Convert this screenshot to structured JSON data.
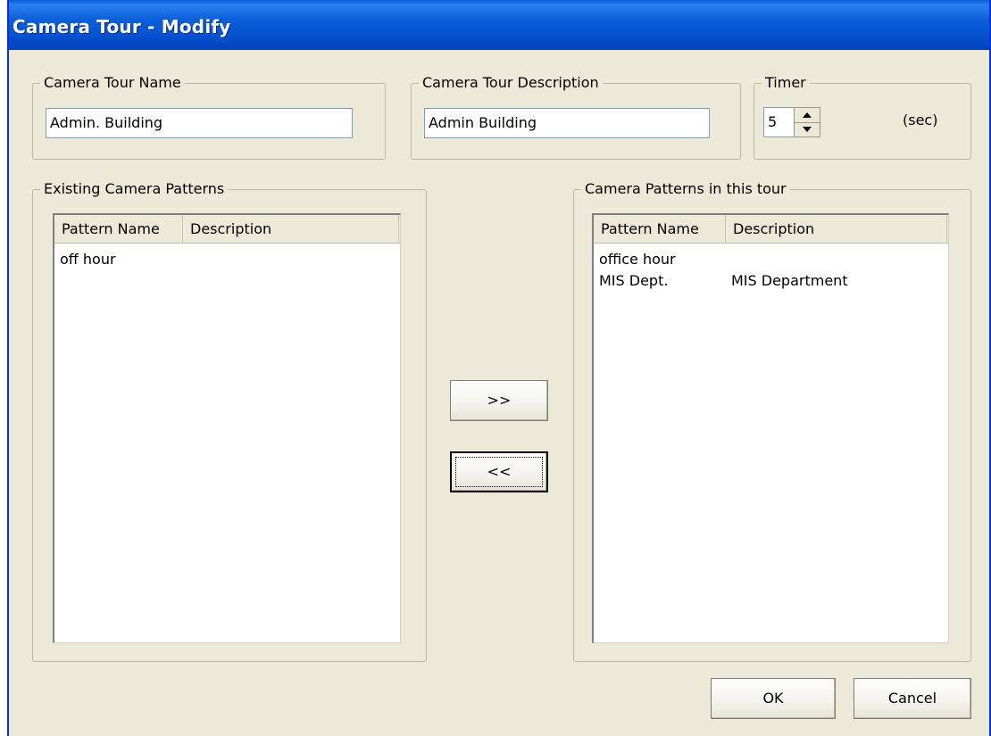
{
  "window": {
    "title": "Camera Tour - Modify"
  },
  "tour_name": {
    "label": "Camera Tour Name",
    "value": "Admin. Building"
  },
  "tour_description": {
    "label": "Camera Tour Description",
    "value": "Admin Building"
  },
  "timer": {
    "label": "Timer",
    "value": "5",
    "unit": "(sec)"
  },
  "existing_patterns": {
    "label": "Existing Camera Patterns",
    "columns": [
      "Pattern Name",
      "Description"
    ],
    "rows": [
      {
        "name": "off hour",
        "description": ""
      }
    ]
  },
  "tour_patterns": {
    "label": "Camera Patterns in this tour",
    "columns": [
      "Pattern Name",
      "Description"
    ],
    "rows": [
      {
        "name": "office hour",
        "description": ""
      },
      {
        "name": "MIS Dept.",
        "description": "MIS Department"
      }
    ]
  },
  "buttons": {
    "add": ">>",
    "remove": "<<",
    "ok": "OK",
    "cancel": "Cancel"
  }
}
